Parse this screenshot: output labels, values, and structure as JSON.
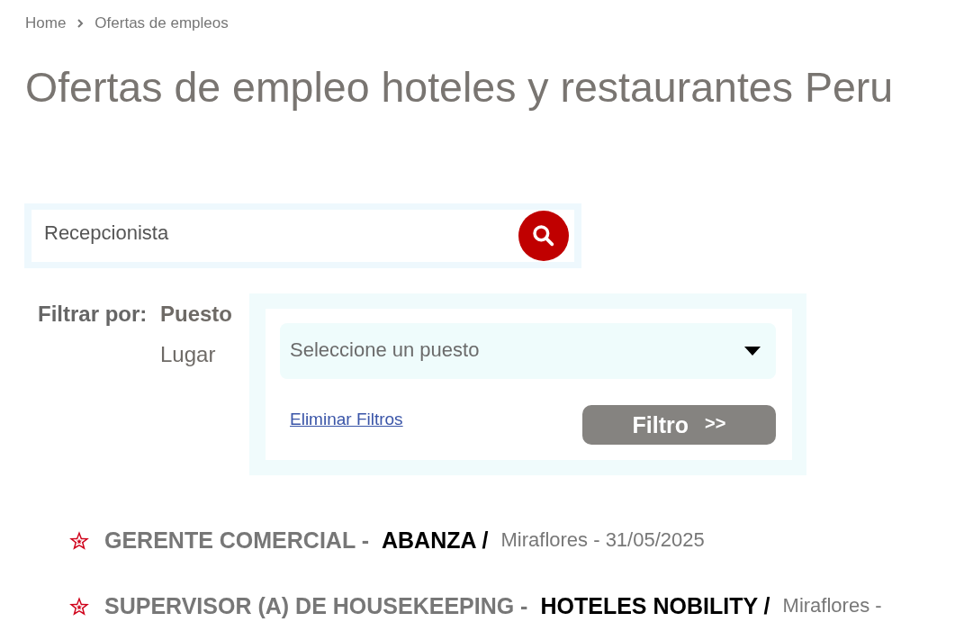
{
  "breadcrumb": [
    {
      "label": "Home"
    },
    {
      "label": "Ofertas de empleos"
    }
  ],
  "title": "Ofertas de empleo hoteles y restaurantes Peru",
  "search": {
    "value": "Recepcionista"
  },
  "filter": {
    "label": "Filtrar por:",
    "tabs": [
      {
        "label": "Puesto",
        "selected": true
      },
      {
        "label": "Lugar",
        "selected": false
      }
    ],
    "select": {
      "placeholder": "Seleccione un puesto"
    },
    "clear_link": "Eliminar Filtros",
    "button": {
      "label": "Filtro",
      "arrows": ">>"
    }
  },
  "jobs": [
    {
      "title": "GERENTE COMERCIAL -",
      "company": "ABANZA /",
      "details": "Miraflores - 31/05/2025"
    },
    {
      "title": "SUPERVISOR (A) DE HOUSEKEEPING -",
      "company": "HOTELES NOBILITY /",
      "details": "Miraflores -"
    }
  ]
}
